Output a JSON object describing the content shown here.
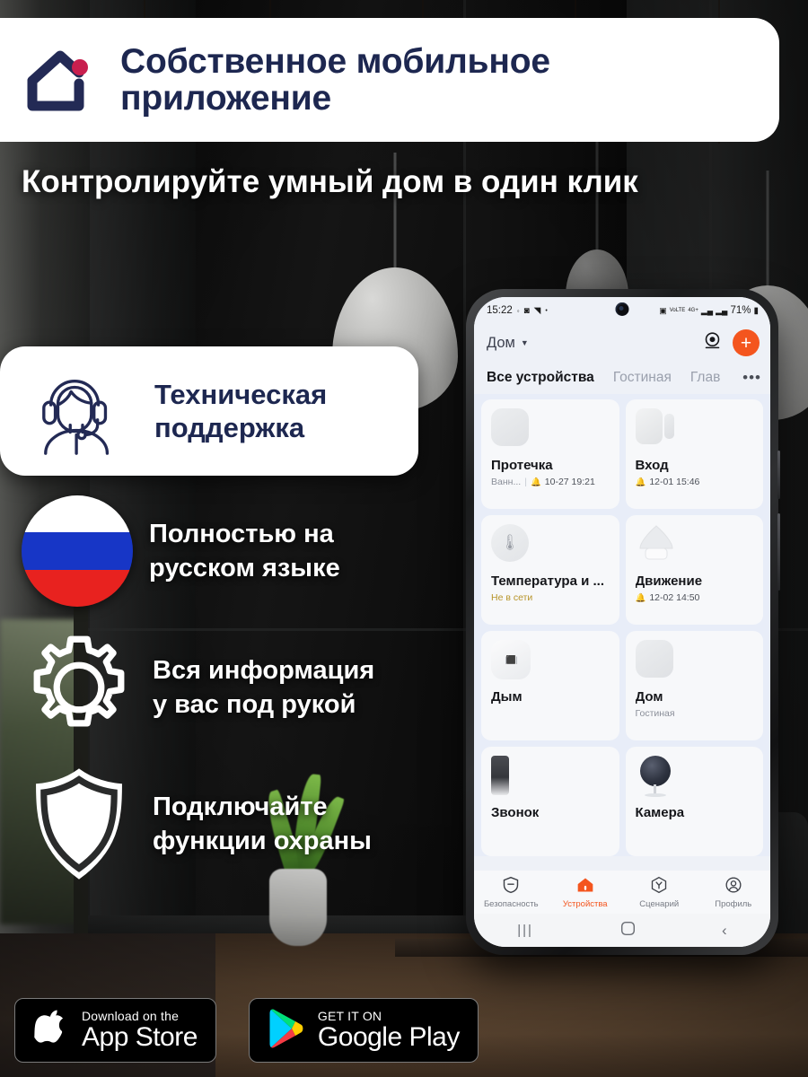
{
  "banner": {
    "logo_icon": "house-dot-logo",
    "title_line1": "Собственное мобильное",
    "title_line2": "приложение"
  },
  "headline": "Контролируйте умный дом в один клик",
  "features": [
    {
      "icon": "headset-support-icon",
      "line1": "Техническая",
      "line2": "поддержка",
      "style": "card"
    },
    {
      "icon": "russian-flag-icon",
      "line1": "Полностью на",
      "line2": "русском языке",
      "style": "plain"
    },
    {
      "icon": "gear-icon",
      "line1": "Вся информация",
      "line2": "у вас под рукой",
      "style": "plain"
    },
    {
      "icon": "shield-icon",
      "line1": "Подключайте",
      "line2": "функции охраны",
      "style": "plain"
    }
  ],
  "phone": {
    "status_bar": {
      "time": "15:22",
      "left_icons": [
        "record-icon",
        "photo-icon",
        "navigation-icon",
        "dot-icon"
      ],
      "right_icons": [
        "alarm-icon",
        "volte-icon",
        "4g-plus-icon",
        "signal-1-icon",
        "signal-2-icon"
      ],
      "battery": "71%",
      "battery_icon": "battery-icon",
      "camera_icon": "front-camera-punchhole"
    },
    "app_header": {
      "home_label": "Дом",
      "dropdown_icon": "chevron-down-icon",
      "camera_icon": "camera-view-icon",
      "add_icon": "plus-icon",
      "accent_color": "#f4551e"
    },
    "tabs": [
      {
        "label": "Все устройства",
        "active": true
      },
      {
        "label": "Гостиная",
        "active": false
      },
      {
        "label": "Глав",
        "active": false
      }
    ],
    "tabs_more_icon": "overflow-dots-icon",
    "devices": [
      {
        "name": "Протечка",
        "icon": "leak-sensor-icon",
        "room": "Ванн...",
        "alert_icon": "bell-icon",
        "alert_level": "red",
        "timestamp": "10-27 19:21"
      },
      {
        "name": "Вход",
        "icon": "door-sensor-icon",
        "room": "",
        "alert_icon": "bell-icon",
        "alert_level": "gray",
        "timestamp": "12-01 15:46"
      },
      {
        "name": "Температура и ...",
        "icon": "thermometer-icon",
        "room": "",
        "alert_icon": "",
        "alert_level": "",
        "timestamp": "",
        "status": "Не в сети"
      },
      {
        "name": "Движение",
        "icon": "motion-sensor-icon",
        "room": "",
        "alert_icon": "bell-icon",
        "alert_level": "amber",
        "timestamp": "12-02 14:50"
      },
      {
        "name": "Дым",
        "icon": "smoke-detector-icon",
        "room": "",
        "alert_icon": "",
        "alert_level": "",
        "timestamp": ""
      },
      {
        "name": "Дом",
        "icon": "hub-icon",
        "room": "Гостиная",
        "alert_icon": "",
        "alert_level": "",
        "timestamp": ""
      },
      {
        "name": "Звонок",
        "icon": "doorbell-icon",
        "room": "",
        "alert_icon": "",
        "alert_level": "",
        "timestamp": ""
      },
      {
        "name": "Камера",
        "icon": "camera-device-icon",
        "room": "",
        "alert_icon": "",
        "alert_level": "",
        "timestamp": ""
      }
    ],
    "bottom_nav": [
      {
        "label": "Безопасность",
        "icon": "shield-minus-icon",
        "active": false
      },
      {
        "label": "Устройства",
        "icon": "home-icon",
        "active": true
      },
      {
        "label": "Сценарий",
        "icon": "scenario-icon",
        "active": false
      },
      {
        "label": "Профиль",
        "icon": "profile-icon",
        "active": false
      }
    ],
    "system_nav": [
      "recents-icon",
      "home-square-icon",
      "back-icon"
    ]
  },
  "stores": [
    {
      "icon": "apple-logo-icon",
      "sub": "Download on the",
      "main": "App Store"
    },
    {
      "icon": "google-play-logo-icon",
      "sub": "GET IT ON",
      "main": "Google Play"
    }
  ]
}
